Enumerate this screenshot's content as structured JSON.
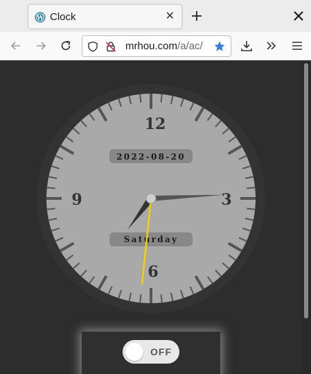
{
  "browser": {
    "tab": {
      "title": "Clock",
      "favicon": "wordpress-icon"
    },
    "url": {
      "host": "mrhou.com",
      "path": "/a/ac/"
    },
    "toolbar": {
      "back_icon": "arrow-left-icon",
      "forward_icon": "arrow-right-icon",
      "reload_icon": "reload-icon",
      "download_icon": "download-icon",
      "overflow_icon": "chevrons-right-icon",
      "menu_icon": "hamburger-menu-icon"
    },
    "accent": "#3d7fd6"
  },
  "clock": {
    "numerals": {
      "twelve": "12",
      "three": "3",
      "six": "6",
      "nine": "9"
    },
    "date": "2022-08-20",
    "weekday": "Saturday",
    "time": {
      "hour": 7,
      "minute": 14,
      "second": 31
    },
    "colors": {
      "second_hand": "#f5d000",
      "face": "#a9a9a9",
      "rim": "#333333"
    }
  },
  "toggle": {
    "label": "OFF",
    "state": "off"
  }
}
